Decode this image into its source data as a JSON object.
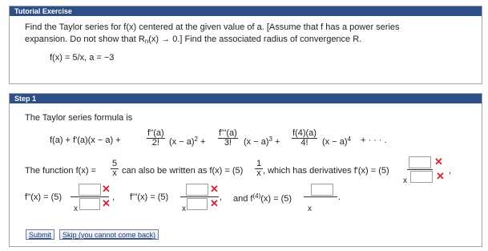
{
  "exercise": {
    "header": "Tutorial Exercise",
    "line1": "Find the Taylor series for f(x) centered at the given value of a. [Assume that f has a power series",
    "line2": "expansion. Do not show that R",
    "line2_sub": "n",
    "line2_rest": "(x) → 0.]  Find the associated radius of convergence R.",
    "func": "f(x) = 5/x,    a = −3"
  },
  "step": {
    "header": "Step 1",
    "intro": "The Taylor series formula is",
    "formula_lead": "f(a) + f'(a)(x − a) +",
    "term2_num": "f''(a)",
    "term2_den": "2!",
    "term2_tail": "(x − a)",
    "term2_pow": "2",
    "term3_num": "f'''(a)",
    "term3_den": "3!",
    "term3_tail": "(x − a)",
    "term3_pow": "3",
    "term4_num": "f(4)(a)",
    "term4_den": "4!",
    "term4_tail": "(x − a)",
    "term4_pow": "4",
    "formula_end": "+  · · · .",
    "rewrite_lead": "The function  f(x) =",
    "rewrite_num": "5",
    "rewrite_den": "x",
    "rewrite_mid": "can also be written as  f(x) = (5)",
    "rewrite_num2": "1",
    "rewrite_den2": "x",
    "rewrite_tail": ", which has derivatives  f'(x) = (5)",
    "d1_den": "x",
    "f2_label": "f''(x) = (5)",
    "f2_den": "x",
    "f3_label": "f'''(x) = (5)",
    "f3_den": "x",
    "and_text": "and  f",
    "and_pow": "(4)",
    "and_rest": "(x) = (5)",
    "f4_den": "x",
    "submit_label": "Submit",
    "skip_label": "Skip (you cannot come back)"
  }
}
